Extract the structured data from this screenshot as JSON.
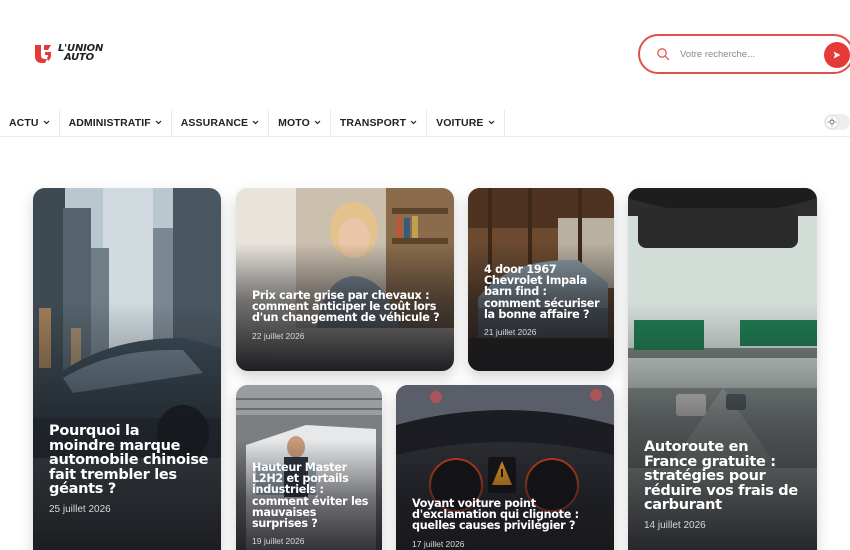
{
  "brand": {
    "line1": "L'UNION",
    "line2": "AUTO"
  },
  "search": {
    "placeholder": "Votre recherche..."
  },
  "nav": {
    "items": [
      {
        "label": "ACTU"
      },
      {
        "label": "ADMINISTRATIF"
      },
      {
        "label": "ASSURANCE"
      },
      {
        "label": "MOTO"
      },
      {
        "label": "TRANSPORT"
      },
      {
        "label": "VOITURE"
      }
    ]
  },
  "colors": {
    "accent": "#e53a37",
    "text": "#222222"
  },
  "articles": [
    {
      "title": "Pourquoi la moindre marque automobile chinoise fait trembler les géants ?",
      "date": "25 juillet 2026"
    },
    {
      "title": "Prix carte grise par chevaux : comment anticiper le coût lors d'un changement de véhicule ?",
      "date": "22 juillet 2026"
    },
    {
      "title": "4 door 1967 Chevrolet Impala barn find : comment sécuriser la bonne affaire ?",
      "date": "21 juillet 2026"
    },
    {
      "title": "Autoroute en France gratuite : stratégies pour réduire vos frais de carburant",
      "date": "14 juillet 2026"
    },
    {
      "title": "Hauteur Master L2H2 et portails industriels : comment éviter les mauvaises surprises ?",
      "date": "19 juillet 2026"
    },
    {
      "title": "Voyant voiture point d'exclamation qui clignote : quelles causes privilégier ?",
      "date": "17 juillet 2026"
    }
  ]
}
